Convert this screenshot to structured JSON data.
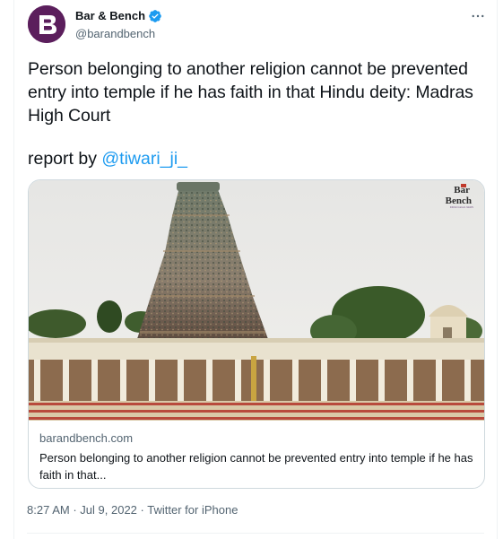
{
  "author": {
    "display_name": "Bar & Bench",
    "handle": "@barandbench",
    "avatar_letter": "B",
    "avatar_color": "#5b1e5c",
    "verified": true
  },
  "tweet": {
    "text": "Person belonging to another religion cannot be prevented entry into temple if he has faith in that Hindu deity: Madras High Court",
    "report_prefix": "report by ",
    "mention": "@tiwari_ji_"
  },
  "card": {
    "image_logo_line1": "Bar",
    "image_logo_line2": "Bench",
    "image_logo_tagline": "INDIAN LEGAL NEWS",
    "domain": "barandbench.com",
    "description": "Person belonging to another religion cannot be prevented entry into temple if he has faith in that..."
  },
  "meta": {
    "time": "8:27 AM",
    "separator": "·",
    "date": "Jul 9, 2022",
    "source": "Twitter for iPhone"
  },
  "colors": {
    "accent": "#1d9bf0",
    "text": "#0f1419",
    "secondary": "#536471",
    "border": "#cfd9de"
  },
  "icons": {
    "verified": "verified-badge-icon",
    "more": "more-horizontal-icon"
  }
}
